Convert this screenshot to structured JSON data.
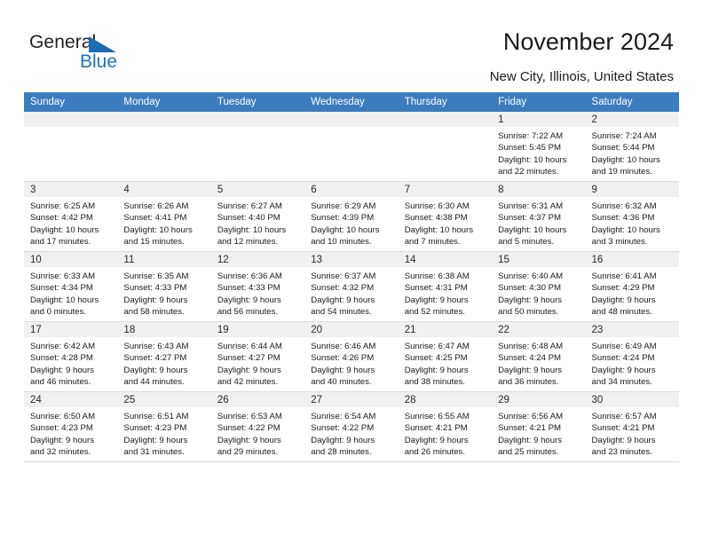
{
  "brand": {
    "name_primary": "General",
    "name_secondary": "Blue",
    "accent_color": "#1b6cb0"
  },
  "header": {
    "title": "November 2024",
    "subtitle": "New City, Illinois, United States"
  },
  "calendar": {
    "header_color": "#3b7dbf",
    "weekday_headers": [
      "Sunday",
      "Monday",
      "Tuesday",
      "Wednesday",
      "Thursday",
      "Friday",
      "Saturday"
    ],
    "weeks": [
      [
        {
          "day": "",
          "sunrise": "",
          "sunset": "",
          "daylight_line1": "",
          "daylight_line2": ""
        },
        {
          "day": "",
          "sunrise": "",
          "sunset": "",
          "daylight_line1": "",
          "daylight_line2": ""
        },
        {
          "day": "",
          "sunrise": "",
          "sunset": "",
          "daylight_line1": "",
          "daylight_line2": ""
        },
        {
          "day": "",
          "sunrise": "",
          "sunset": "",
          "daylight_line1": "",
          "daylight_line2": ""
        },
        {
          "day": "",
          "sunrise": "",
          "sunset": "",
          "daylight_line1": "",
          "daylight_line2": ""
        },
        {
          "day": "1",
          "sunrise": "Sunrise: 7:22 AM",
          "sunset": "Sunset: 5:45 PM",
          "daylight_line1": "Daylight: 10 hours",
          "daylight_line2": "and 22 minutes."
        },
        {
          "day": "2",
          "sunrise": "Sunrise: 7:24 AM",
          "sunset": "Sunset: 5:44 PM",
          "daylight_line1": "Daylight: 10 hours",
          "daylight_line2": "and 19 minutes."
        }
      ],
      [
        {
          "day": "3",
          "sunrise": "Sunrise: 6:25 AM",
          "sunset": "Sunset: 4:42 PM",
          "daylight_line1": "Daylight: 10 hours",
          "daylight_line2": "and 17 minutes."
        },
        {
          "day": "4",
          "sunrise": "Sunrise: 6:26 AM",
          "sunset": "Sunset: 4:41 PM",
          "daylight_line1": "Daylight: 10 hours",
          "daylight_line2": "and 15 minutes."
        },
        {
          "day": "5",
          "sunrise": "Sunrise: 6:27 AM",
          "sunset": "Sunset: 4:40 PM",
          "daylight_line1": "Daylight: 10 hours",
          "daylight_line2": "and 12 minutes."
        },
        {
          "day": "6",
          "sunrise": "Sunrise: 6:29 AM",
          "sunset": "Sunset: 4:39 PM",
          "daylight_line1": "Daylight: 10 hours",
          "daylight_line2": "and 10 minutes."
        },
        {
          "day": "7",
          "sunrise": "Sunrise: 6:30 AM",
          "sunset": "Sunset: 4:38 PM",
          "daylight_line1": "Daylight: 10 hours",
          "daylight_line2": "and 7 minutes."
        },
        {
          "day": "8",
          "sunrise": "Sunrise: 6:31 AM",
          "sunset": "Sunset: 4:37 PM",
          "daylight_line1": "Daylight: 10 hours",
          "daylight_line2": "and 5 minutes."
        },
        {
          "day": "9",
          "sunrise": "Sunrise: 6:32 AM",
          "sunset": "Sunset: 4:36 PM",
          "daylight_line1": "Daylight: 10 hours",
          "daylight_line2": "and 3 minutes."
        }
      ],
      [
        {
          "day": "10",
          "sunrise": "Sunrise: 6:33 AM",
          "sunset": "Sunset: 4:34 PM",
          "daylight_line1": "Daylight: 10 hours",
          "daylight_line2": "and 0 minutes."
        },
        {
          "day": "11",
          "sunrise": "Sunrise: 6:35 AM",
          "sunset": "Sunset: 4:33 PM",
          "daylight_line1": "Daylight: 9 hours",
          "daylight_line2": "and 58 minutes."
        },
        {
          "day": "12",
          "sunrise": "Sunrise: 6:36 AM",
          "sunset": "Sunset: 4:33 PM",
          "daylight_line1": "Daylight: 9 hours",
          "daylight_line2": "and 56 minutes."
        },
        {
          "day": "13",
          "sunrise": "Sunrise: 6:37 AM",
          "sunset": "Sunset: 4:32 PM",
          "daylight_line1": "Daylight: 9 hours",
          "daylight_line2": "and 54 minutes."
        },
        {
          "day": "14",
          "sunrise": "Sunrise: 6:38 AM",
          "sunset": "Sunset: 4:31 PM",
          "daylight_line1": "Daylight: 9 hours",
          "daylight_line2": "and 52 minutes."
        },
        {
          "day": "15",
          "sunrise": "Sunrise: 6:40 AM",
          "sunset": "Sunset: 4:30 PM",
          "daylight_line1": "Daylight: 9 hours",
          "daylight_line2": "and 50 minutes."
        },
        {
          "day": "16",
          "sunrise": "Sunrise: 6:41 AM",
          "sunset": "Sunset: 4:29 PM",
          "daylight_line1": "Daylight: 9 hours",
          "daylight_line2": "and 48 minutes."
        }
      ],
      [
        {
          "day": "17",
          "sunrise": "Sunrise: 6:42 AM",
          "sunset": "Sunset: 4:28 PM",
          "daylight_line1": "Daylight: 9 hours",
          "daylight_line2": "and 46 minutes."
        },
        {
          "day": "18",
          "sunrise": "Sunrise: 6:43 AM",
          "sunset": "Sunset: 4:27 PM",
          "daylight_line1": "Daylight: 9 hours",
          "daylight_line2": "and 44 minutes."
        },
        {
          "day": "19",
          "sunrise": "Sunrise: 6:44 AM",
          "sunset": "Sunset: 4:27 PM",
          "daylight_line1": "Daylight: 9 hours",
          "daylight_line2": "and 42 minutes."
        },
        {
          "day": "20",
          "sunrise": "Sunrise: 6:46 AM",
          "sunset": "Sunset: 4:26 PM",
          "daylight_line1": "Daylight: 9 hours",
          "daylight_line2": "and 40 minutes."
        },
        {
          "day": "21",
          "sunrise": "Sunrise: 6:47 AM",
          "sunset": "Sunset: 4:25 PM",
          "daylight_line1": "Daylight: 9 hours",
          "daylight_line2": "and 38 minutes."
        },
        {
          "day": "22",
          "sunrise": "Sunrise: 6:48 AM",
          "sunset": "Sunset: 4:24 PM",
          "daylight_line1": "Daylight: 9 hours",
          "daylight_line2": "and 36 minutes."
        },
        {
          "day": "23",
          "sunrise": "Sunrise: 6:49 AM",
          "sunset": "Sunset: 4:24 PM",
          "daylight_line1": "Daylight: 9 hours",
          "daylight_line2": "and 34 minutes."
        }
      ],
      [
        {
          "day": "24",
          "sunrise": "Sunrise: 6:50 AM",
          "sunset": "Sunset: 4:23 PM",
          "daylight_line1": "Daylight: 9 hours",
          "daylight_line2": "and 32 minutes."
        },
        {
          "day": "25",
          "sunrise": "Sunrise: 6:51 AM",
          "sunset": "Sunset: 4:23 PM",
          "daylight_line1": "Daylight: 9 hours",
          "daylight_line2": "and 31 minutes."
        },
        {
          "day": "26",
          "sunrise": "Sunrise: 6:53 AM",
          "sunset": "Sunset: 4:22 PM",
          "daylight_line1": "Daylight: 9 hours",
          "daylight_line2": "and 29 minutes."
        },
        {
          "day": "27",
          "sunrise": "Sunrise: 6:54 AM",
          "sunset": "Sunset: 4:22 PM",
          "daylight_line1": "Daylight: 9 hours",
          "daylight_line2": "and 28 minutes."
        },
        {
          "day": "28",
          "sunrise": "Sunrise: 6:55 AM",
          "sunset": "Sunset: 4:21 PM",
          "daylight_line1": "Daylight: 9 hours",
          "daylight_line2": "and 26 minutes."
        },
        {
          "day": "29",
          "sunrise": "Sunrise: 6:56 AM",
          "sunset": "Sunset: 4:21 PM",
          "daylight_line1": "Daylight: 9 hours",
          "daylight_line2": "and 25 minutes."
        },
        {
          "day": "30",
          "sunrise": "Sunrise: 6:57 AM",
          "sunset": "Sunset: 4:21 PM",
          "daylight_line1": "Daylight: 9 hours",
          "daylight_line2": "and 23 minutes."
        }
      ]
    ]
  }
}
